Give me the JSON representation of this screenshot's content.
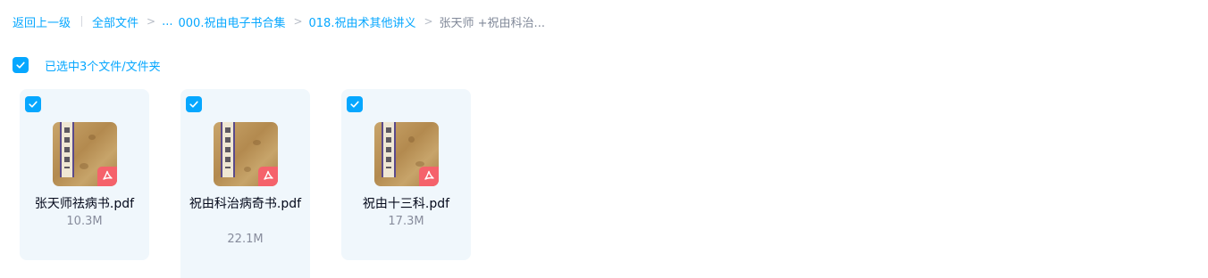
{
  "breadcrumb": {
    "back": "返回上一级",
    "all_files": "全部文件",
    "ellipsis": "...",
    "folder1": "000.祝由电子书合集",
    "folder2": "018.祝由术其他讲义",
    "current": "张天师 +祝由科治...",
    "separator": ">"
  },
  "selection": {
    "label": "已选中3个文件/文件夹",
    "checked": true
  },
  "files": [
    {
      "name": "张天师祛病书.pdf",
      "size": "10.3M",
      "type": "pdf",
      "selected": true
    },
    {
      "name": "祝由科治病奇书.pdf",
      "size": "22.1M",
      "type": "pdf",
      "selected": true
    },
    {
      "name": "祝由十三科.pdf",
      "size": "17.3M",
      "type": "pdf",
      "selected": true
    }
  ],
  "colors": {
    "accent": "#06a7ff",
    "card_bg": "#f0f7fc",
    "pdf_badge": "#f5626b"
  },
  "icons": {
    "checkbox": "check-icon",
    "file_type": "pdf-icon"
  }
}
